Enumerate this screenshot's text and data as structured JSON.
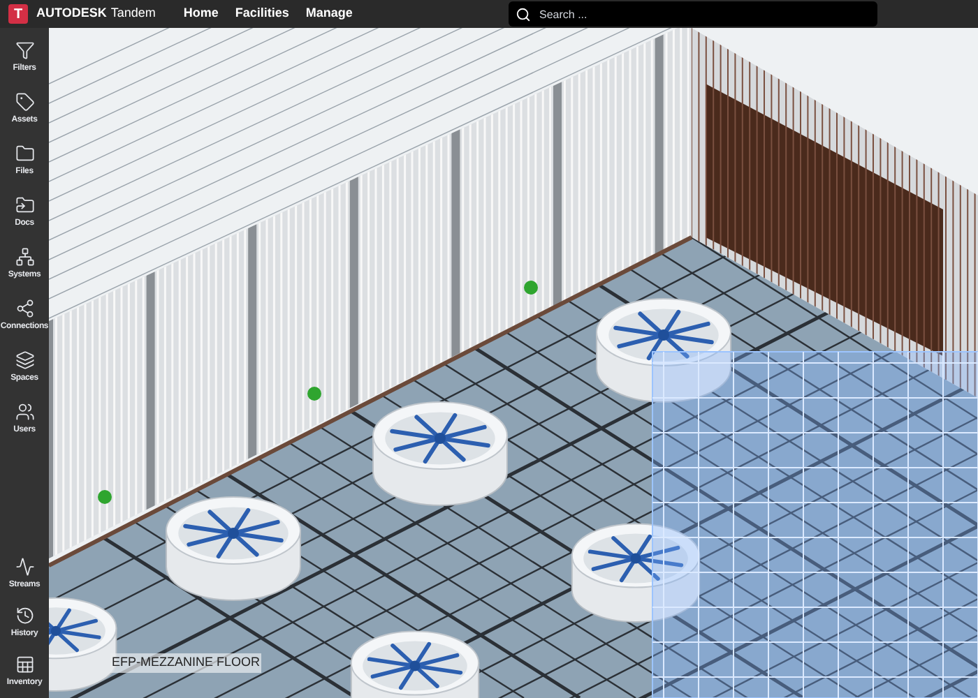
{
  "top_bar": {
    "logo_letter": "T",
    "brand": "AUTODESK",
    "product": "Tandem",
    "nav": [
      {
        "label": "Home"
      },
      {
        "label": "Facilities"
      },
      {
        "label": "Manage"
      }
    ],
    "search": {
      "placeholder": "Search ..."
    }
  },
  "sidebar": {
    "items": [
      {
        "label": "Filters",
        "kind": "filter"
      },
      {
        "label": "Assets",
        "kind": "tag"
      },
      {
        "label": "Files",
        "kind": "folder"
      },
      {
        "label": "Docs",
        "kind": "docs"
      },
      {
        "label": "Systems",
        "kind": "network"
      },
      {
        "label": "Connections",
        "kind": "connections"
      },
      {
        "label": "Spaces",
        "kind": "layers"
      },
      {
        "label": "Users",
        "kind": "users"
      }
    ],
    "bottom_items": [
      {
        "label": "Streams",
        "kind": "activity"
      },
      {
        "label": "History",
        "kind": "history"
      },
      {
        "label": "Inventory",
        "kind": "table"
      }
    ]
  },
  "viewport": {
    "level_label": "EFP-MEZZANINE FLOOR"
  }
}
